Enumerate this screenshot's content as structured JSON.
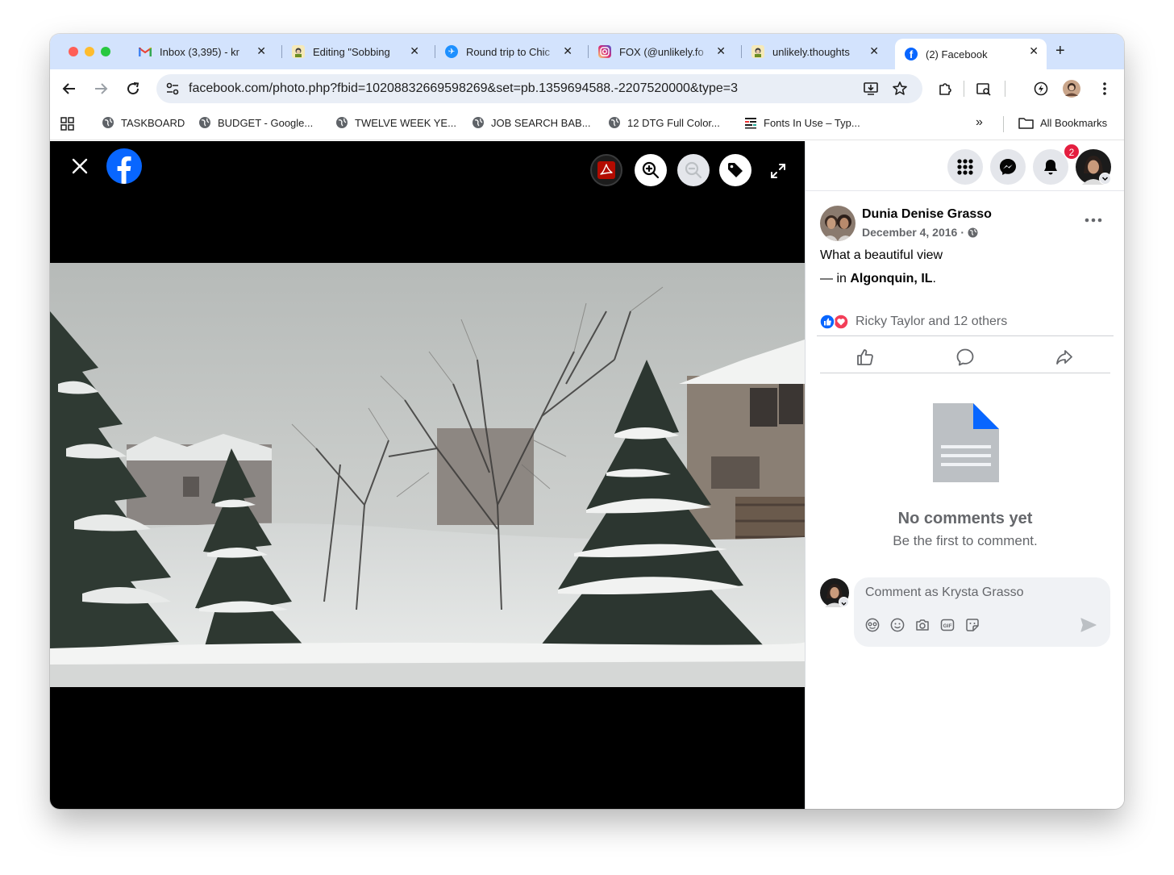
{
  "browser": {
    "tabs": [
      {
        "label": "Inbox (3,395) - kr",
        "favicon": "gmail-icon"
      },
      {
        "label": "Editing \"Sobbing",
        "favicon": "substack-avatar-icon"
      },
      {
        "label": "Round trip to Chic",
        "favicon": "flight-icon"
      },
      {
        "label": "FOX (@unlikely.fo",
        "favicon": "instagram-icon"
      },
      {
        "label": "unlikely.thoughts",
        "favicon": "substack-avatar-icon"
      },
      {
        "label": "(2) Facebook",
        "favicon": "facebook-icon"
      }
    ],
    "url": "facebook.com/photo.php?fbid=10208832669598269&set=pb.1359694588.-2207520000&type=3",
    "bookmarks": [
      "TASKBOARD",
      "BUDGET - Google...",
      "TWELVE WEEK YE...",
      "JOB SEARCH BAB...",
      "12 DTG Full Color...",
      "Fonts In Use – Typ..."
    ],
    "all_bookmarks": "All Bookmarks"
  },
  "panel": {
    "notification_count": "2",
    "post": {
      "author": "Dunia Denise Grasso",
      "date": "December 4, 2016",
      "date_separator": "·",
      "caption": "What a beautiful view",
      "location_prefix": "— in ",
      "location": "Algonquin, IL",
      "location_suffix": ".",
      "reactions_text": "Ricky Taylor and 12 others"
    },
    "empty_state": {
      "title": "No comments yet",
      "subtitle": "Be the first to comment."
    },
    "comment_placeholder": "Comment as Krysta Grasso"
  },
  "colors": {
    "facebook_blue": "#0866ff",
    "tab_strip": "#d3e3fd",
    "notification_red": "#e41e3f",
    "love_red": "#f33e58"
  }
}
